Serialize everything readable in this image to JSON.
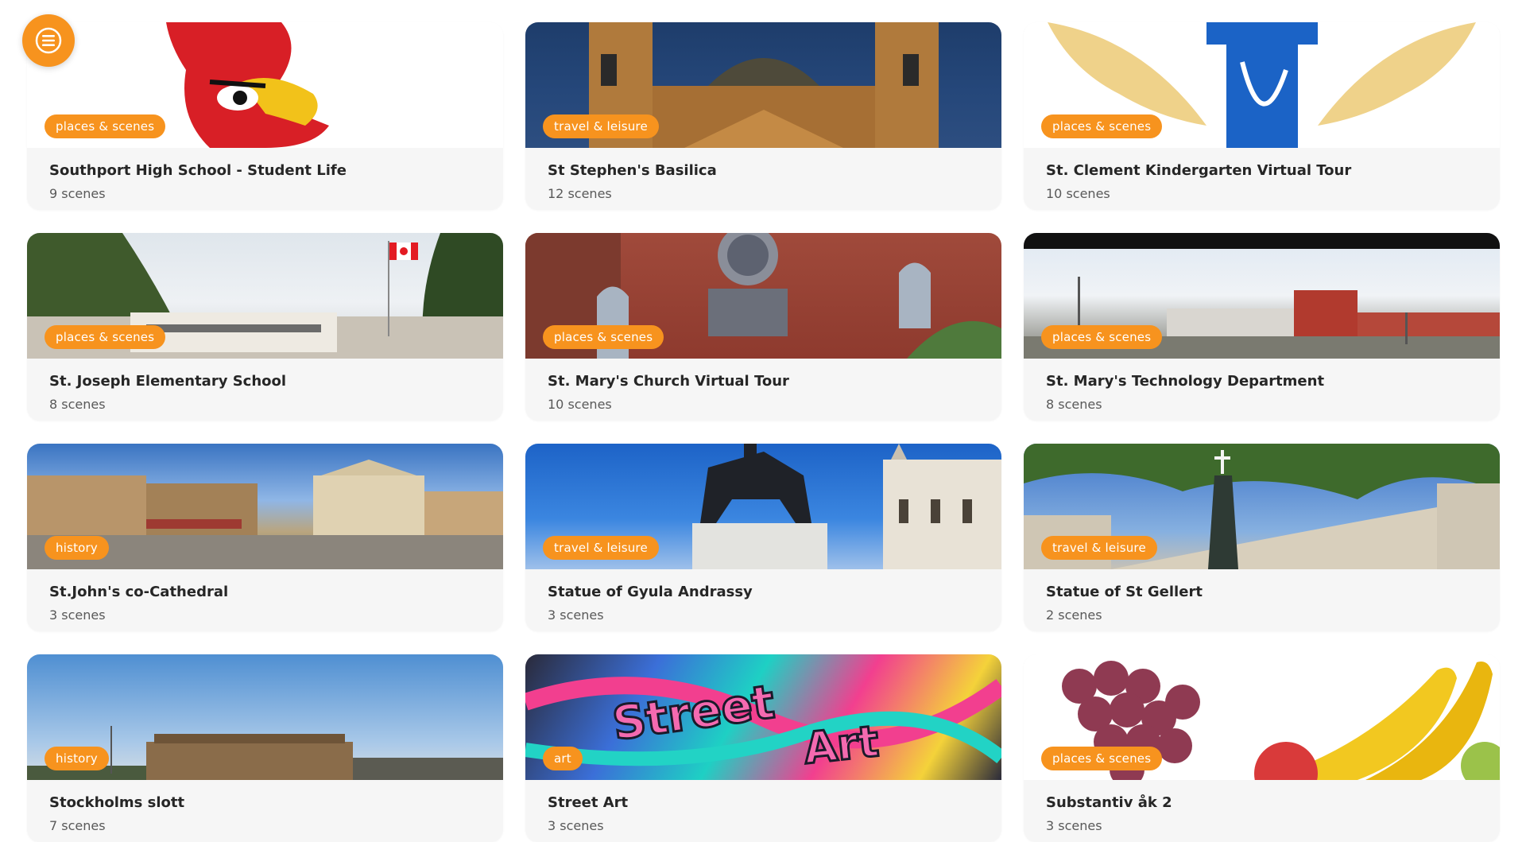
{
  "menu": {
    "icon": "hamburger-menu-icon",
    "color": "#f7931e"
  },
  "colors": {
    "accent": "#f7931e",
    "card_bg": "#f6f6f6",
    "title": "#262626",
    "subtitle": "#595959"
  },
  "tours": [
    {
      "title": "Southport High School - Student Life",
      "scenes": "9 scenes",
      "category": "places & scenes",
      "image": "cardinal-mascot-logo"
    },
    {
      "title": "St Stephen's Basilica",
      "scenes": "12 scenes",
      "category": "travel & leisure",
      "image": "basilica-towers-at-dusk"
    },
    {
      "title": "St. Clement Kindergarten Virtual Tour",
      "scenes": "10 scenes",
      "category": "places & scenes",
      "image": "winged-cross-emblem"
    },
    {
      "title": "St. Joseph Elementary School",
      "scenes": "8 scenes",
      "category": "places & scenes",
      "image": "school-building-with-flag"
    },
    {
      "title": "St. Mary's Church Virtual Tour",
      "scenes": "10 scenes",
      "category": "places & scenes",
      "image": "brick-church-facade"
    },
    {
      "title": "St. Mary's Technology Department",
      "scenes": "8 scenes",
      "category": "places & scenes",
      "image": "school-campus-panorama"
    },
    {
      "title": "St.John's co-Cathedral",
      "scenes": "3 scenes",
      "category": "history",
      "image": "cathedral-square-panorama"
    },
    {
      "title": "Statue of Gyula Andrassy",
      "scenes": "3 scenes",
      "category": "travel & leisure",
      "image": "equestrian-statue-parliament"
    },
    {
      "title": "Statue of St Gellert",
      "scenes": "2 scenes",
      "category": "travel & leisure",
      "image": "statue-with-cross-trees"
    },
    {
      "title": "Stockholms slott",
      "scenes": "7 scenes",
      "category": "history",
      "image": "royal-palace-panorama"
    },
    {
      "title": "Street Art",
      "scenes": "3 scenes",
      "category": "art",
      "image": "graffiti-wall"
    },
    {
      "title": "Substantiv åk 2",
      "scenes": "3 scenes",
      "category": "places & scenes",
      "image": "grapes-and-bananas"
    }
  ]
}
